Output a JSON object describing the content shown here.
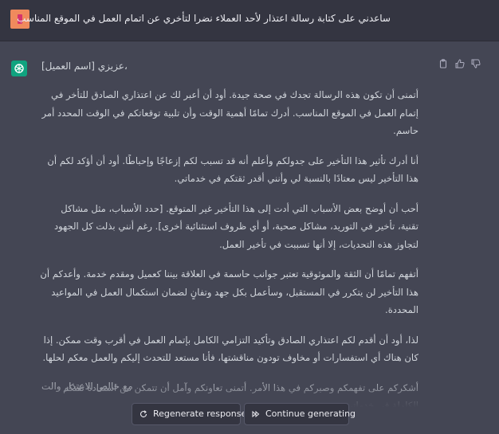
{
  "user_message": {
    "text": "ساعدني على كتابة رسالة اعتذار لأحد العملاء نضرا لتأخري عن اتمام العمل في الموقع المناسب",
    "avatar_color": "#f08a5d"
  },
  "assistant_message": {
    "avatar_color": "#10a37f",
    "greeting": "عزيزي [اسم العميل]،",
    "paragraphs": [
      "أتمنى أن تكون هذه الرسالة تجدك في صحة جيدة. أود أن أعبر لك عن اعتذاري الصادق للتأخر في إتمام العمل في الموقع المناسب. أدرك تمامًا أهمية الوقت وأن تلبية توقعاتكم في الوقت المحدد أمر حاسم.",
      "أنا أدرك تأثير هذا التأخير على جدولكم وأعلم أنه قد تسبب لكم إزعاجًا وإحباطًا. أود أن أؤكد لكم أن هذا التأخير ليس معتادًا بالنسبة لي وأنني أقدر ثقتكم في خدماتي.",
      "أحب أن أوضح بعض الأسباب التي أدت إلى هذا التأخير غير المتوقع. [حدد الأسباب، مثل مشاكل تقنية، تأخير في التوريد، مشاكل صحية، أو أي ظروف استثنائية أخرى]. رغم أنني بذلت كل الجهود لتجاوز هذه التحديات، إلا أنها تسببت في تأخير العمل.",
      "أتفهم تمامًا أن الثقة والموثوقية تعتبر جوانب حاسمة في العلاقة بيننا كعميل ومقدم خدمة. وأعدكم أن هذا التأخير لن يتكرر في المستقبل، وسأعمل بكل جهد وتفانٍ لضمان استكمال العمل في المواعيد المحددة.",
      "لذا، أود أن أقدم لكم اعتذاري الصادق وتأكيد التزامي الكامل بإتمام العمل في أقرب وقت ممكن. إذا كان هناك أي استفسارات أو مخاوف تودون مناقشتها، فأنا مستعد للتحدث إليكم والعمل معكم لحلها.",
      "أشكركم على تفهمكم وصبركم في هذا الأمر. أتمنى تعاونكم وآمل أن تتمكن من استعادة ثقتكم الكاملة في خدماتي."
    ],
    "closing": "مع خالص الاعتذار والت",
    "action_icons": [
      "copy-icon",
      "thumbs-up-icon",
      "thumbs-down-icon"
    ]
  },
  "controls": {
    "regenerate_label": "Regenerate response",
    "continue_label": "Continue generating"
  },
  "colors": {
    "user_bg": "#343541",
    "assistant_bg": "#444654",
    "text": "#d1d5db",
    "accent": "#10a37f"
  }
}
